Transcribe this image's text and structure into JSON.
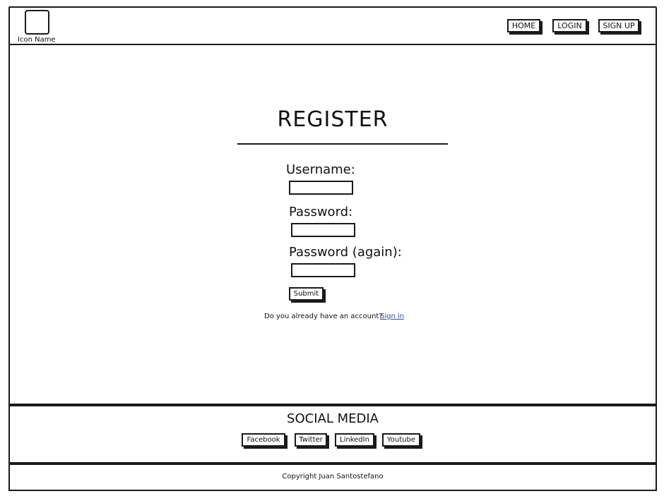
{
  "header": {
    "logo_label": "Icon Name",
    "nav": {
      "home": "HOME",
      "login": "LOGIN",
      "signup": "SIGN UP"
    }
  },
  "main": {
    "title": "REGISTER",
    "fields": {
      "username_label": "Username:",
      "username_value": "",
      "password_label": "Password:",
      "password_value": "",
      "password_again_label": "Password (again):",
      "password_again_value": ""
    },
    "submit_label": "Submit",
    "signin_prompt": "Do you already have an account?",
    "signin_link": "Sign in",
    "link_color": "#1f5aa8"
  },
  "social": {
    "title": "SOCIAL MEDIA",
    "links": {
      "facebook": "Facebook",
      "twitter": "Twitter",
      "linkedin": "LinkedIn",
      "youtube": "Youtube"
    }
  },
  "footer": {
    "copyright": "Copyright Juan Santostefano"
  }
}
